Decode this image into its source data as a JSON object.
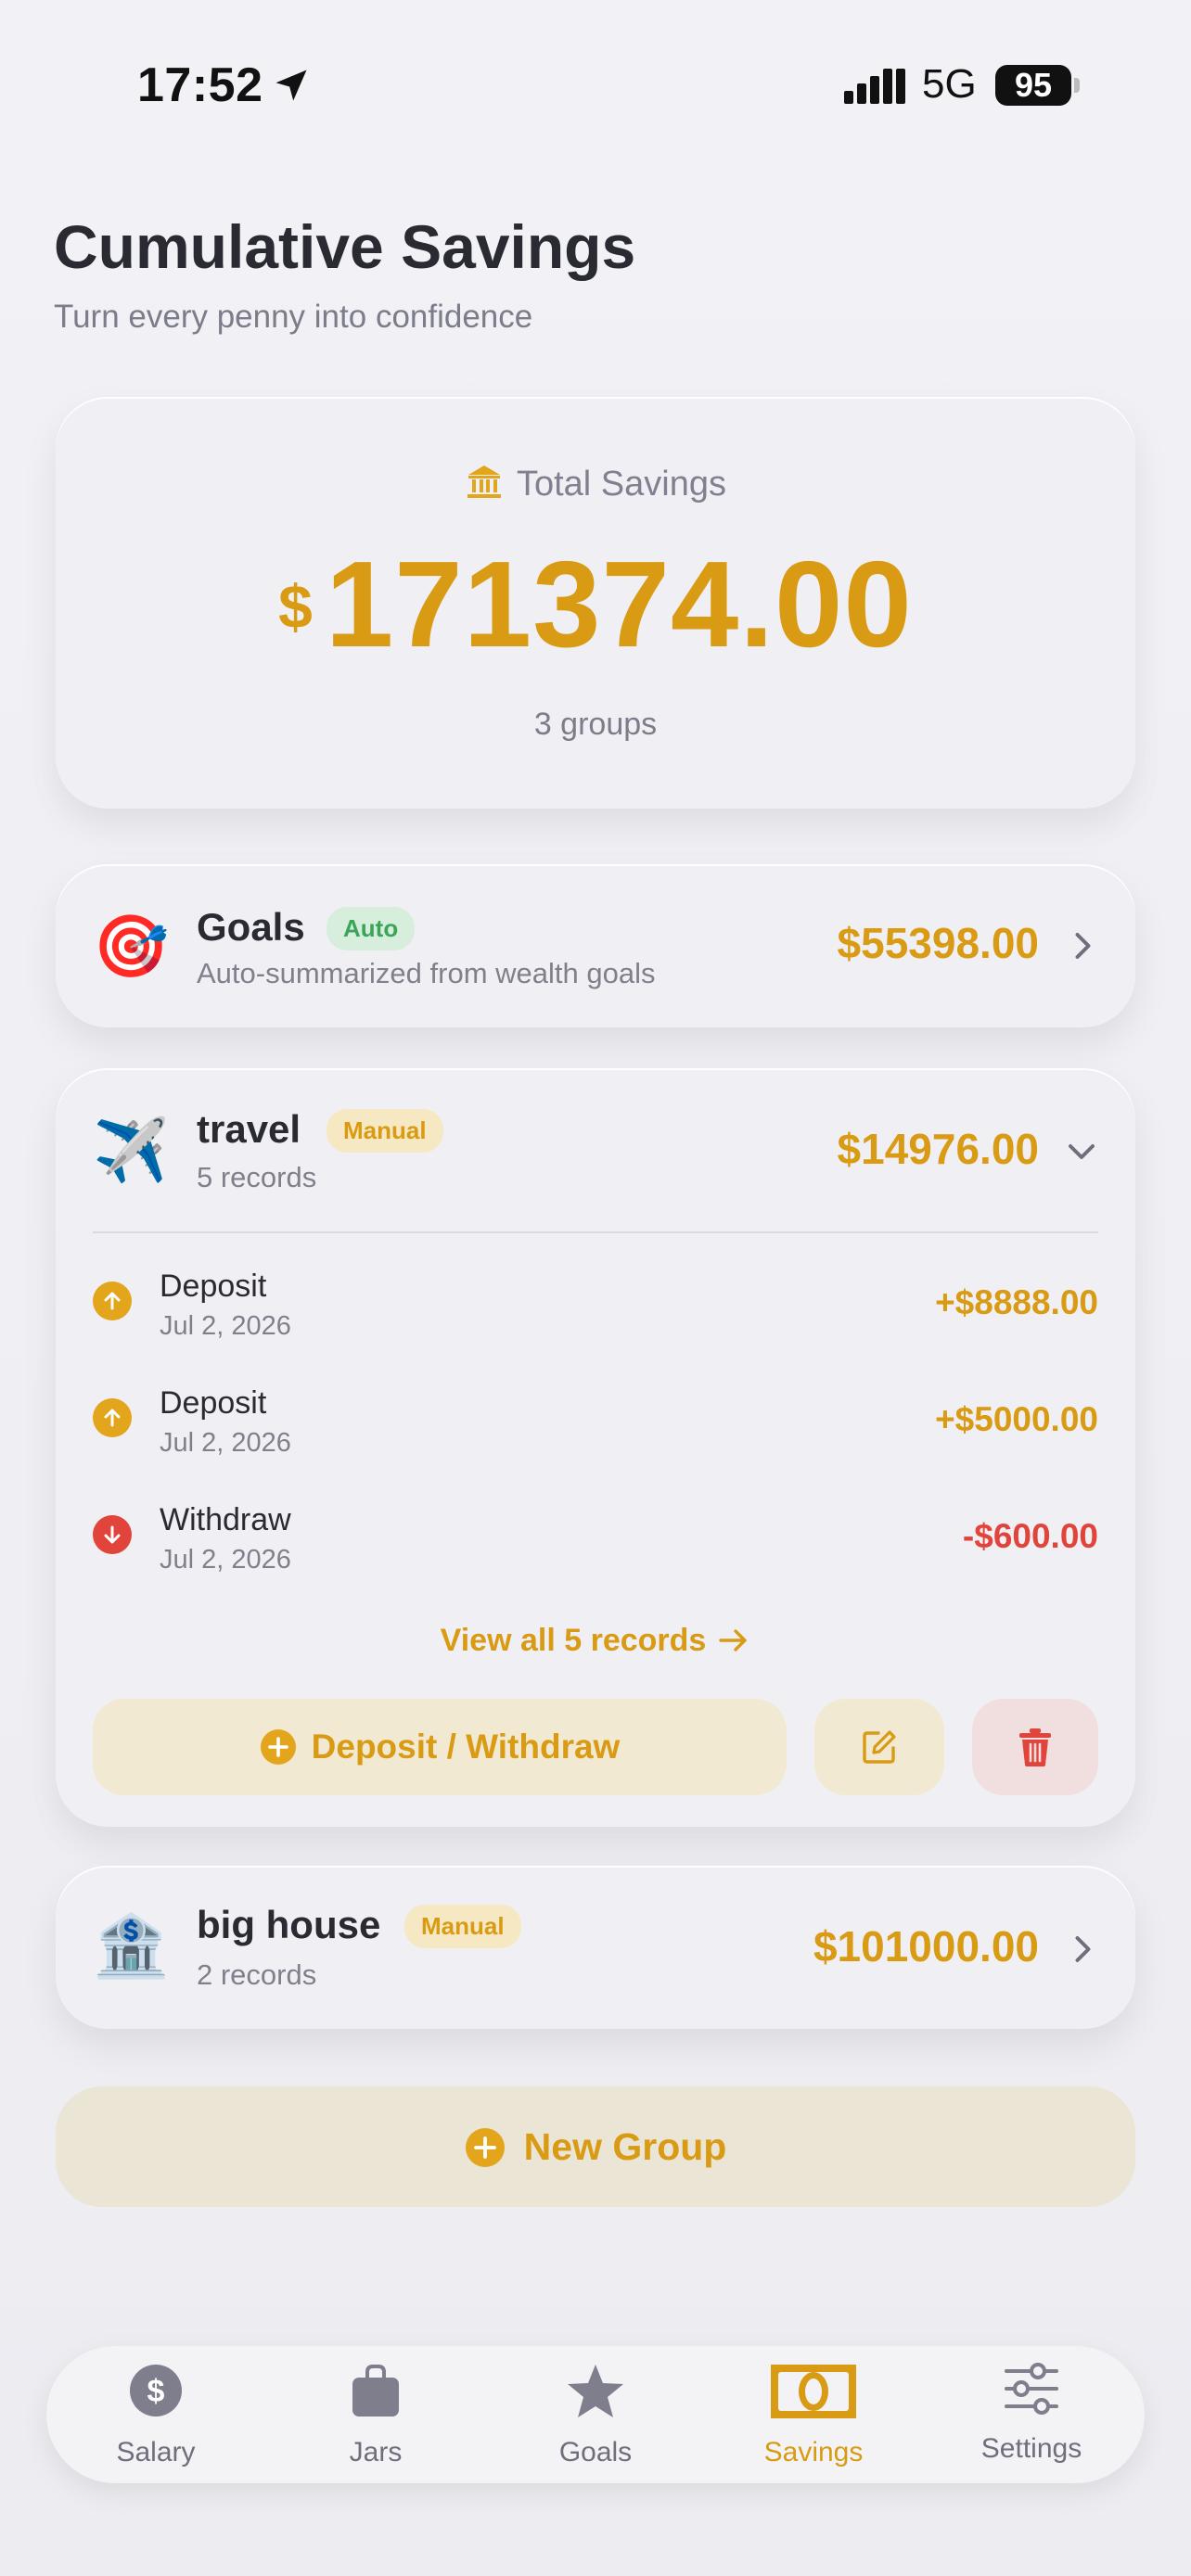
{
  "status": {
    "time": "17:52",
    "network": "5G",
    "battery": "95"
  },
  "header": {
    "title": "Cumulative Savings",
    "subtitle": "Turn every penny into confidence"
  },
  "total": {
    "label": "Total Savings",
    "currency": "$",
    "amount": "171374.00",
    "groups": "3 groups"
  },
  "groups": [
    {
      "emoji": "🎯",
      "name": "Goals",
      "badge": "Auto",
      "subtitle": "Auto-summarized from wealth goals",
      "amount": "$55398.00"
    },
    {
      "emoji": "✈️",
      "name": "travel",
      "badge": "Manual",
      "subtitle": "5 records",
      "amount": "$14976.00",
      "records": [
        {
          "type": "Deposit",
          "date": "Jul 2, 2026",
          "amount": "+$8888.00"
        },
        {
          "type": "Deposit",
          "date": "Jul 2, 2026",
          "amount": "+$5000.00"
        },
        {
          "type": "Withdraw",
          "date": "Jul 2, 2026",
          "amount": "-$600.00"
        }
      ],
      "view_all": "View all 5 records",
      "deposit_withdraw": "Deposit / Withdraw"
    },
    {
      "emoji": "🏦",
      "name": "big house",
      "badge": "Manual",
      "subtitle": "2 records",
      "amount": "$101000.00"
    }
  ],
  "new_group": "New Group",
  "tabs": [
    {
      "label": "Salary",
      "icon": "dollar-circle-icon"
    },
    {
      "label": "Jars",
      "icon": "bag-icon"
    },
    {
      "label": "Goals",
      "icon": "star-icon"
    },
    {
      "label": "Savings",
      "icon": "banknote-icon"
    },
    {
      "label": "Settings",
      "icon": "sliders-icon"
    }
  ],
  "colors": {
    "accent": "#d99a14",
    "negative": "#e0443a",
    "auto_badge": "#3aa55a",
    "background": "#efeff4"
  }
}
